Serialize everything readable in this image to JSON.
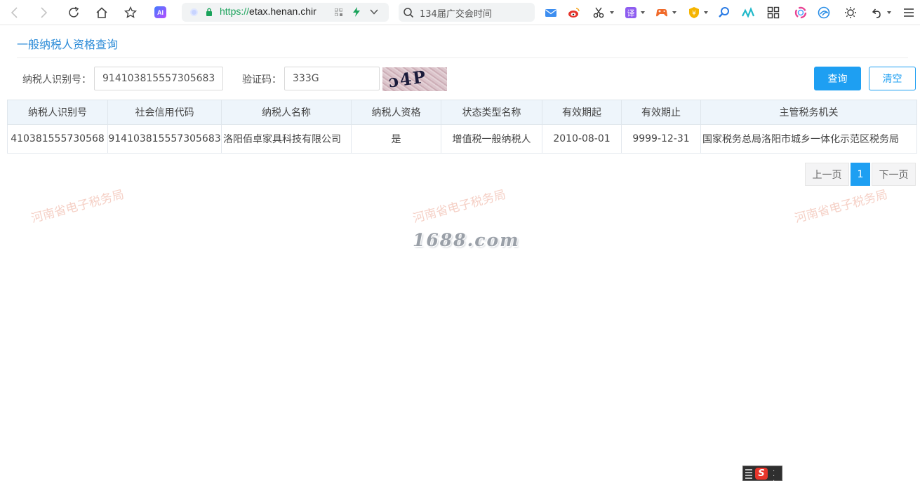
{
  "browser": {
    "url_protocol": "https://",
    "url_host": "etax.henan.chir",
    "search_placeholder": "134届广交会时间",
    "ai_label": "AI",
    "ext_translate": "译",
    "ext_yen": "¥"
  },
  "page": {
    "title": "一般纳税人资格查询"
  },
  "form": {
    "taxpayer_id_label": "纳税人识别号：",
    "taxpayer_id_value": "914103815557305683",
    "captcha_label": "验证码：",
    "captcha_value": "333G",
    "captcha_chars": "ɔ4P",
    "query_button": "查询",
    "clear_button": "清空"
  },
  "table": {
    "headers": [
      "纳税人识别号",
      "社会信用代码",
      "纳税人名称",
      "纳税人资格",
      "状态类型名称",
      "有效期起",
      "有效期止",
      "主管税务机关"
    ],
    "rows": [
      [
        "410381555730568",
        "914103815557305683",
        "洛阳佰卓家具科技有限公司",
        "是",
        "增值税一般纳税人",
        "2010-08-01",
        "9999-12-31",
        "国家税务总局洛阳市城乡一体化示范区税务局"
      ]
    ]
  },
  "pagination": {
    "prev": "上一页",
    "current": "1",
    "next": "下一页"
  },
  "watermarks": {
    "text": "河南省电子税务局",
    "site": "1688.com"
  },
  "ime": {
    "logo": "S"
  },
  "colors": {
    "accent": "#1e9ff2",
    "title": "#2d8cd8",
    "header_bg": "#eef5fb",
    "watermark": "#f0b8a8"
  }
}
